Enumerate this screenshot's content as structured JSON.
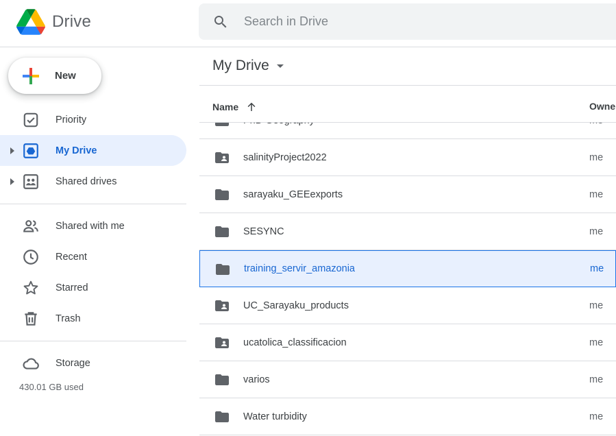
{
  "app": {
    "name": "Drive"
  },
  "search": {
    "placeholder": "Search in Drive"
  },
  "new_button": {
    "label": "New"
  },
  "sidebar": {
    "items": [
      {
        "label": "Priority",
        "icon": "priority-icon"
      },
      {
        "label": "My Drive",
        "icon": "my-drive-icon",
        "active": true
      },
      {
        "label": "Shared drives",
        "icon": "shared-drives-icon"
      },
      {
        "label": "Shared with me",
        "icon": "shared-with-me-icon"
      },
      {
        "label": "Recent",
        "icon": "clock-icon"
      },
      {
        "label": "Starred",
        "icon": "star-icon"
      },
      {
        "label": "Trash",
        "icon": "trash-icon"
      },
      {
        "label": "Storage",
        "icon": "cloud-icon"
      }
    ],
    "storage_used": "430.01 GB used"
  },
  "main": {
    "title": "My Drive",
    "columns": {
      "name": "Name",
      "owner": "Owner"
    },
    "rows": [
      {
        "name": "PhD Geography",
        "owner": "me",
        "type": "folder"
      },
      {
        "name": "salinityProject2022",
        "owner": "me",
        "type": "shared-folder"
      },
      {
        "name": "sarayaku_GEEexports",
        "owner": "me",
        "type": "folder"
      },
      {
        "name": "SESYNC",
        "owner": "me",
        "type": "folder"
      },
      {
        "name": "training_servir_amazonia",
        "owner": "me",
        "type": "folder",
        "selected": true
      },
      {
        "name": "UC_Sarayaku_products",
        "owner": "me",
        "type": "shared-folder"
      },
      {
        "name": "ucatolica_classificacion",
        "owner": "me",
        "type": "shared-folder"
      },
      {
        "name": "varios",
        "owner": "me",
        "type": "folder"
      },
      {
        "name": "Water turbidity",
        "owner": "me",
        "type": "folder"
      }
    ]
  },
  "colors": {
    "accent": "#1a73e8",
    "active_bg": "#e8f0fe",
    "active_text": "#1967d2",
    "folder": "#5f6368"
  }
}
